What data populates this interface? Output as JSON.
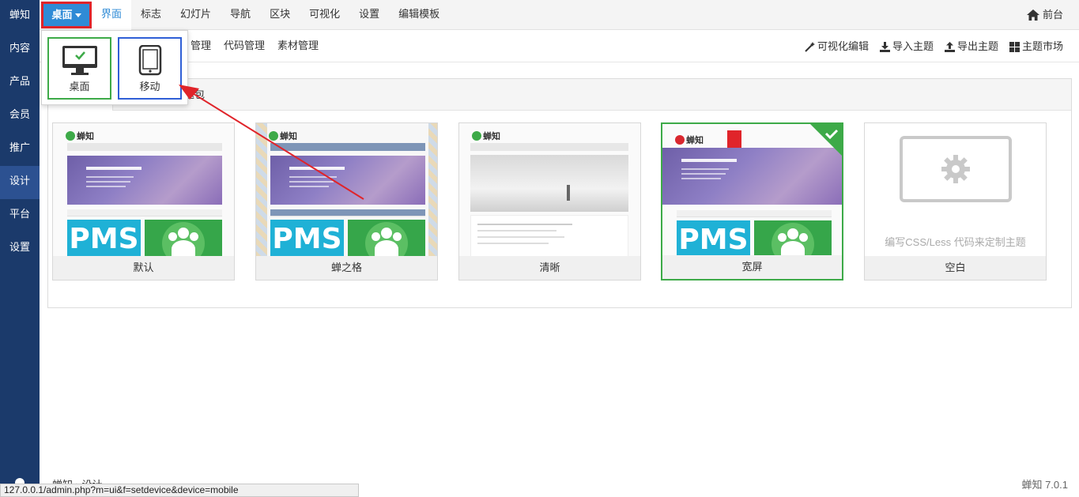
{
  "sidebar": {
    "brand": "蝉知",
    "items": [
      {
        "label": "内容"
      },
      {
        "label": "产品"
      },
      {
        "label": "会员"
      },
      {
        "label": "推广"
      },
      {
        "label": "设计"
      },
      {
        "label": "平台"
      },
      {
        "label": "设置"
      }
    ]
  },
  "topnav": {
    "device_label": "桌面",
    "menu": [
      "界面",
      "标志",
      "幻灯片",
      "导航",
      "区块",
      "可视化",
      "设置",
      "编辑模板"
    ],
    "frontdesk": "前台"
  },
  "subbar": {
    "left": [
      "管理",
      "代码管理",
      "素材管理"
    ],
    "right": [
      "可视化编辑",
      "导入主题",
      "导出主题",
      "主题市场"
    ]
  },
  "panel": {
    "tab_label": "题包"
  },
  "themes": [
    {
      "name": "默认"
    },
    {
      "name": "蝉之格"
    },
    {
      "name": "清晰"
    },
    {
      "name": "宽屏",
      "selected": true
    },
    {
      "name": "空白",
      "hint": "编写CSS/Less 代码来定制主题"
    }
  ],
  "preview_text": {
    "logo": "蝉知",
    "pms": "PMS"
  },
  "dropdown": {
    "options": [
      {
        "label": "桌面"
      },
      {
        "label": "移动"
      }
    ]
  },
  "footer": {
    "breadcrumb": "蝉知 › 设计",
    "version": "蝉知 7.0.1",
    "status_url": "127.0.0.1/admin.php?m=ui&f=setdevice&device=mobile"
  },
  "colors": {
    "sidebar": "#1b3a6b",
    "accent": "#2f8bd6",
    "highlight": "#e0242a",
    "selected": "#3daa48"
  }
}
